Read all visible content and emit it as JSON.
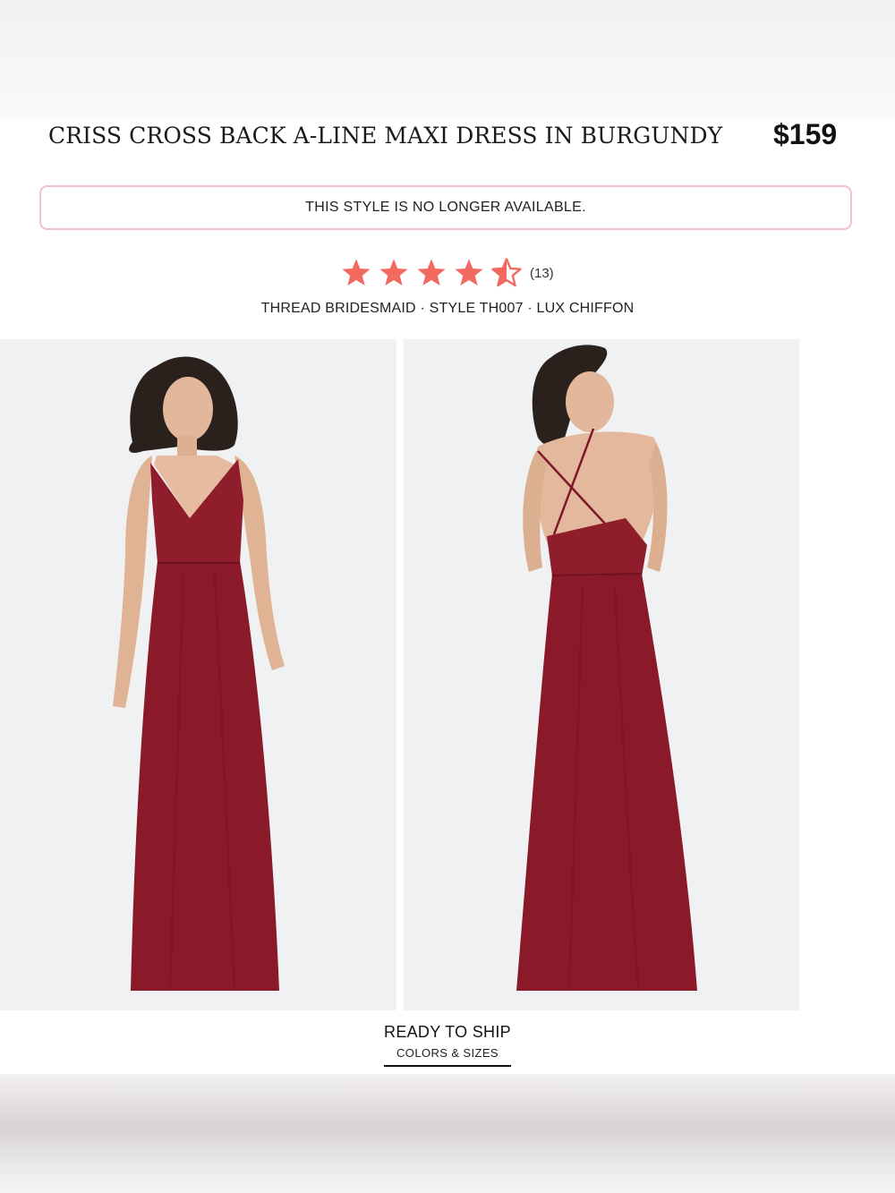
{
  "product": {
    "title": "CRISS CROSS BACK A-LINE MAXI DRESS IN BURGUNDY",
    "price": "$159",
    "availability_notice": "THIS STYLE IS NO LONGER AVAILABLE.",
    "rating": {
      "value": 4.5,
      "max": 5,
      "count_label": "(13)",
      "star_color": "#f2695f"
    },
    "meta_line": "THREAD BRIDESMAID · STYLE TH007 · LUX CHIFFON",
    "dress_color": "#8f1d2c"
  },
  "images": [
    {
      "view": "front"
    },
    {
      "view": "back"
    }
  ],
  "shipping": {
    "title": "READY TO SHIP",
    "subtitle": "COLORS & SIZES"
  },
  "colors": {
    "notice_border": "#f3c2c8",
    "photo_background": "#f0f1f3"
  }
}
